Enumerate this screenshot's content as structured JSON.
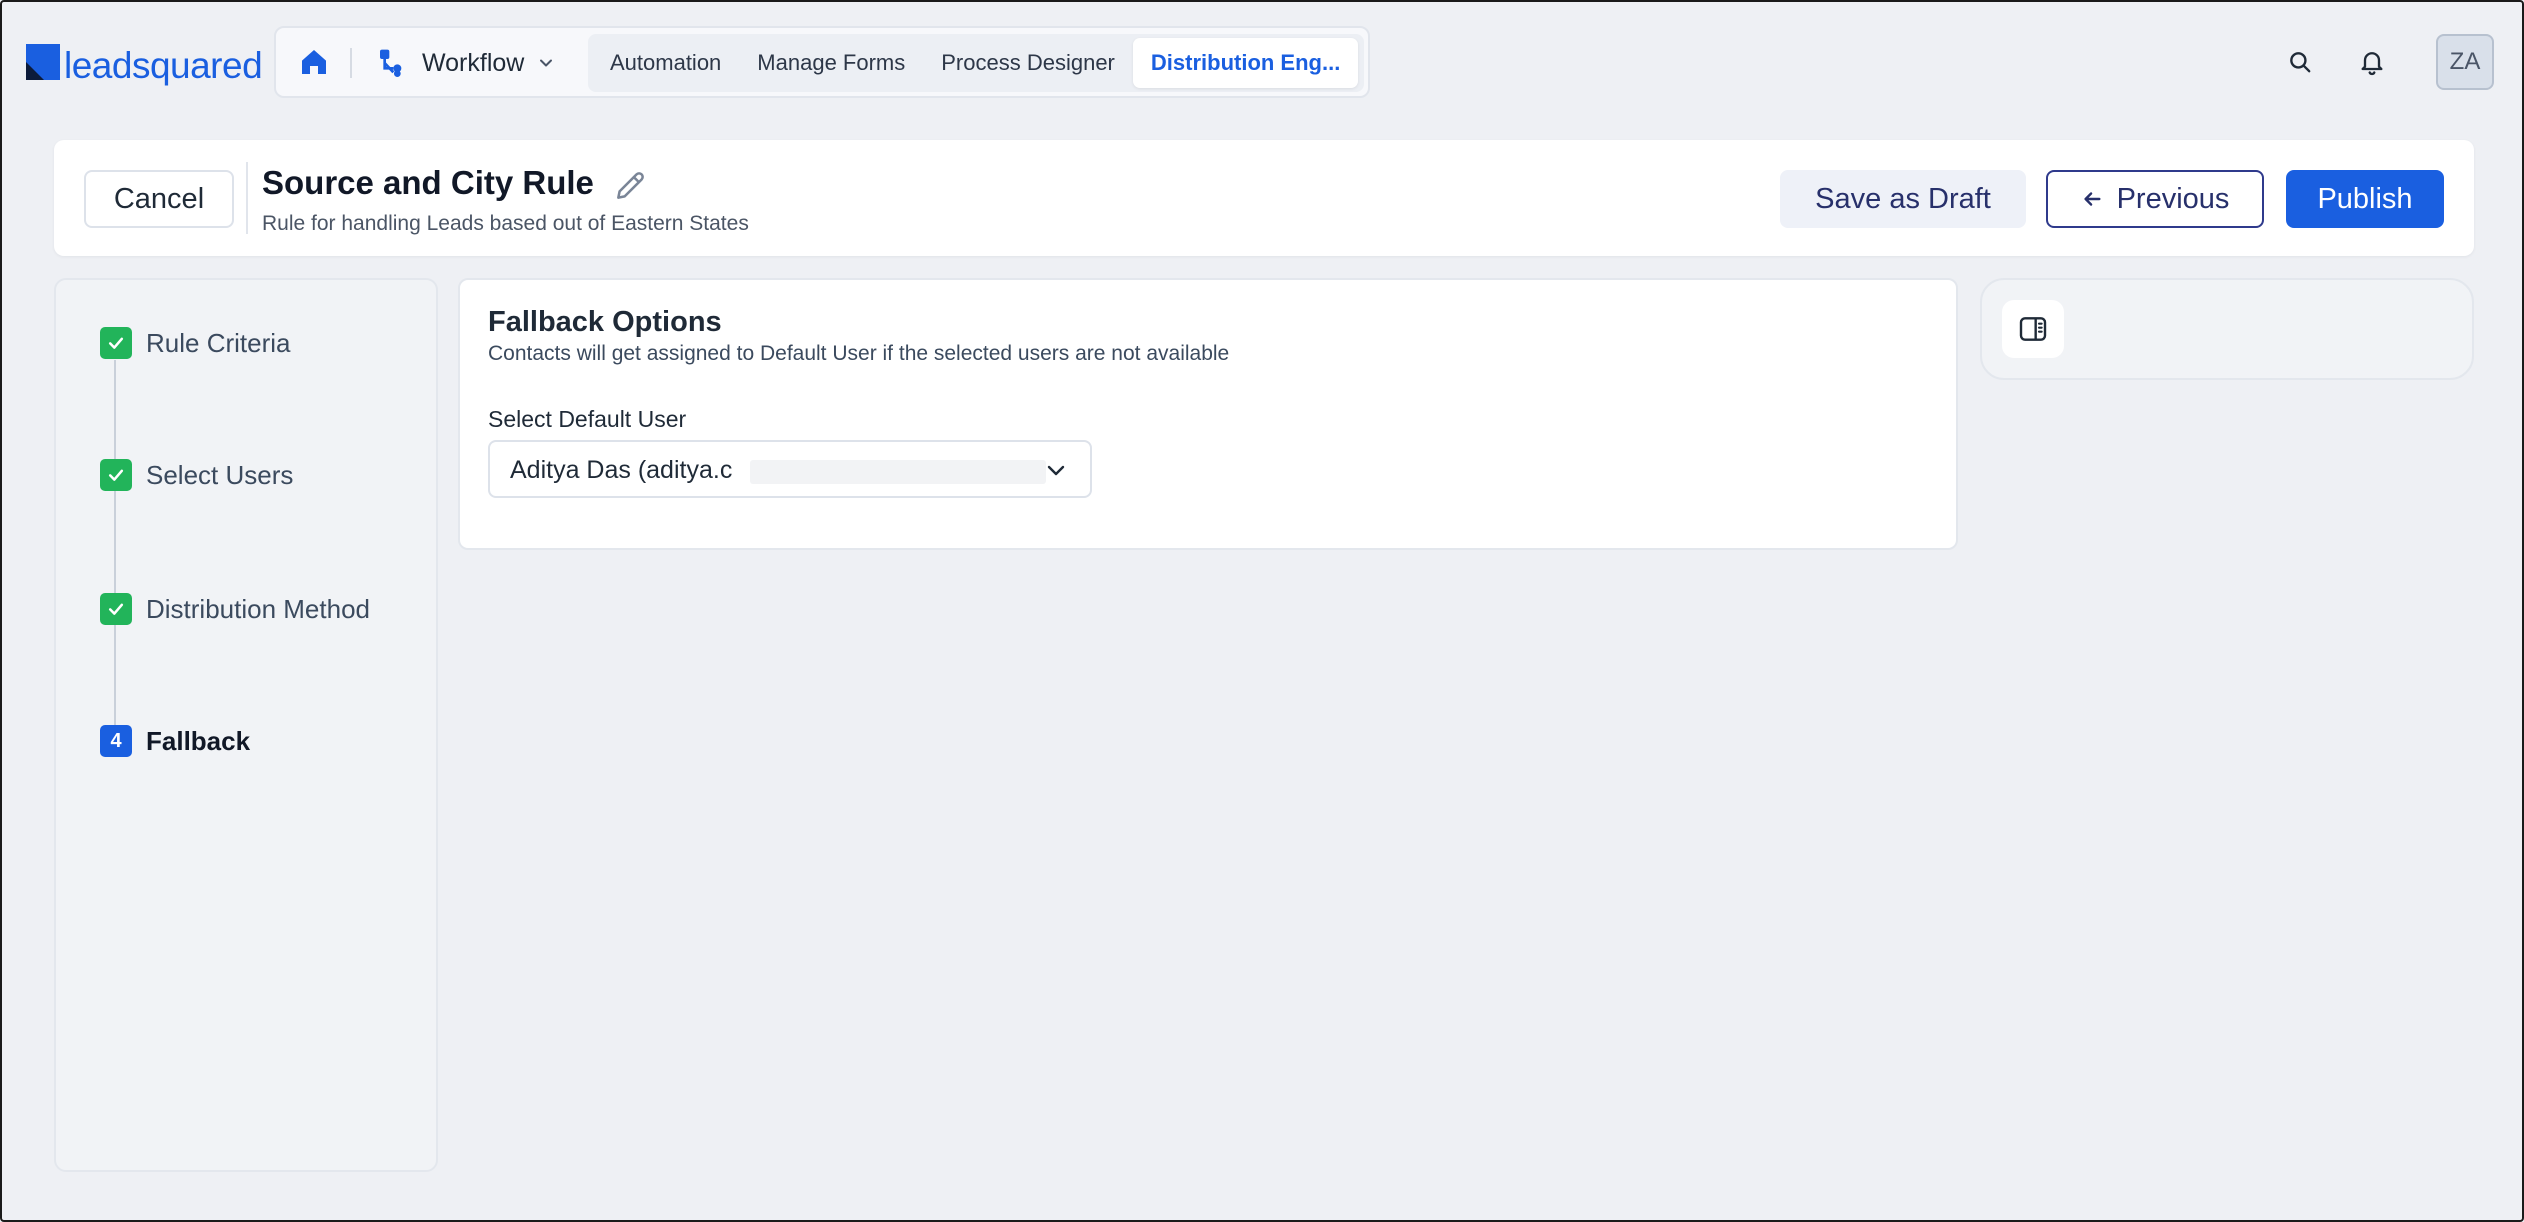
{
  "brand": {
    "logo_text": "leadsquared"
  },
  "nav": {
    "workflow_label": "Workflow",
    "tabs": [
      {
        "label": "Automation",
        "active": false
      },
      {
        "label": "Manage Forms",
        "active": false
      },
      {
        "label": "Process Designer",
        "active": false
      },
      {
        "label": "Distribution Eng...",
        "active": true
      }
    ],
    "avatar_initials": "ZA"
  },
  "header": {
    "cancel_label": "Cancel",
    "title": "Source and City Rule",
    "description": "Rule for handling Leads based out of Eastern States",
    "save_draft_label": "Save as Draft",
    "previous_label": "Previous",
    "publish_label": "Publish"
  },
  "steps": [
    {
      "label": "Rule Criteria",
      "status": "done"
    },
    {
      "label": "Select Users",
      "status": "done"
    },
    {
      "label": "Distribution Method",
      "status": "done"
    },
    {
      "label": "Fallback",
      "status": "current",
      "number": "4"
    }
  ],
  "fallback": {
    "title": "Fallback Options",
    "description": "Contacts will get assigned to Default User if the selected users are not available",
    "field_label": "Select Default User",
    "selected_user": "Aditya Das (aditya.c"
  },
  "colors": {
    "brand_blue": "#1a5fe0",
    "success_green": "#22b45a",
    "navy_text": "#27306b"
  },
  "icons": {
    "home": "home-icon",
    "workflow": "workflow-icon",
    "search": "search-icon",
    "notifications": "bell-icon",
    "edit": "pencil-icon",
    "previous": "arrow-left-icon",
    "check": "check-icon",
    "dropdown": "chevron-down-icon",
    "panel": "sidebar-panel-icon"
  }
}
